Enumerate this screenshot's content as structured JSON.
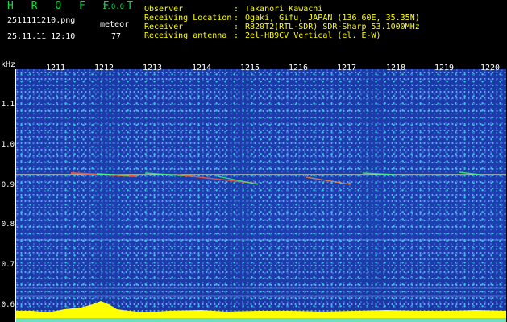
{
  "header": {
    "app_title": "H R O F F T",
    "version": "1.0.0",
    "filename": "2511111210.png",
    "datetime": "25.11.11 12:10",
    "meteor_label": "meteor",
    "meteor_count": "77",
    "info": [
      {
        "label": "Observer",
        "value": "Takanori Kawachi"
      },
      {
        "label": "Receiving Location",
        "value": "Ogaki, Gifu, JAPAN (136.60E, 35.35N)"
      },
      {
        "label": "Receiver",
        "value": "R820T2(RTL-SDR) SDR-Sharp 53.1000MHz"
      },
      {
        "label": "Receiving antenna",
        "value": "2el-HB9CV Vertical (el. E-W)"
      }
    ],
    "separator": ":"
  },
  "axes": {
    "y_unit": "kHz",
    "y_ticks": [
      "1.1",
      "1.0",
      "0.9",
      "0.8",
      "0.7",
      "0.6"
    ],
    "x_ticks": [
      "1211",
      "1212",
      "1213",
      "1214",
      "1215",
      "1216",
      "1217",
      "1218",
      "1219",
      "1220"
    ]
  },
  "colors": {
    "background": "#1d40b0",
    "header_text": "#ffff00",
    "title_green": "#00e040",
    "carrier": "#f0f0a0",
    "baseline_noise": "#ffff00"
  }
}
